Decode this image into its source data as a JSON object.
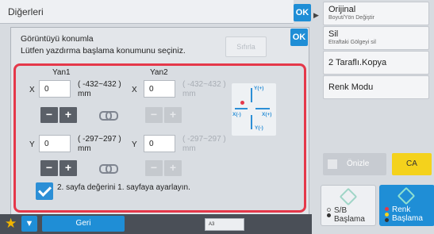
{
  "back_panel": {
    "title": "Diğerleri",
    "ok_label": "OK"
  },
  "right_menu": {
    "items": [
      {
        "main": "Orijinal",
        "sub": "Boyut/Yön Değiştir"
      },
      {
        "main": "Sil",
        "sub": "Etraftaki Gölgeyi sil"
      },
      {
        "main": "2 Taraflı.Kopya",
        "sub": ""
      },
      {
        "main": "Renk Modu",
        "sub": ""
      }
    ],
    "preview_label": "Önizle",
    "ca_label": "CA",
    "start_bw_label": [
      "S/B",
      "Başlama"
    ],
    "start_color_label": [
      "Renk",
      "Başlama"
    ]
  },
  "dialog": {
    "title": "Görüntüyü konumla",
    "instruction": "Lütfen yazdırma başlama konumunu seçiniz.",
    "clear_label": "Sıfırla",
    "ok_label": "OK",
    "side1_header": "Yan1",
    "side2_header": "Yan2",
    "x_label": "X",
    "y_label": "Y",
    "side1_x_value": "0",
    "side2_x_value": "0",
    "side1_y_value": "0",
    "side2_y_value": "0",
    "x_range": "( -432~432 )",
    "y_range": "( -297~297 )",
    "unit": "mm",
    "minus_label": "−",
    "plus_label": "+",
    "diagram": {
      "y_plus": "Y(+)",
      "y_minus": "Y(-)",
      "x_plus": "X(+)",
      "x_minus": "X(-)"
    },
    "checkbox_checked": true,
    "checkbox_label": "2. sayfa değerini 1. sayfaya ayarlayın."
  },
  "bottom_bar": {
    "back_label": "Geri",
    "tray_label": "A3"
  },
  "colors": {
    "accent": "#1f8ed6",
    "highlight": "#e5384a",
    "ca": "#f4d21c"
  }
}
